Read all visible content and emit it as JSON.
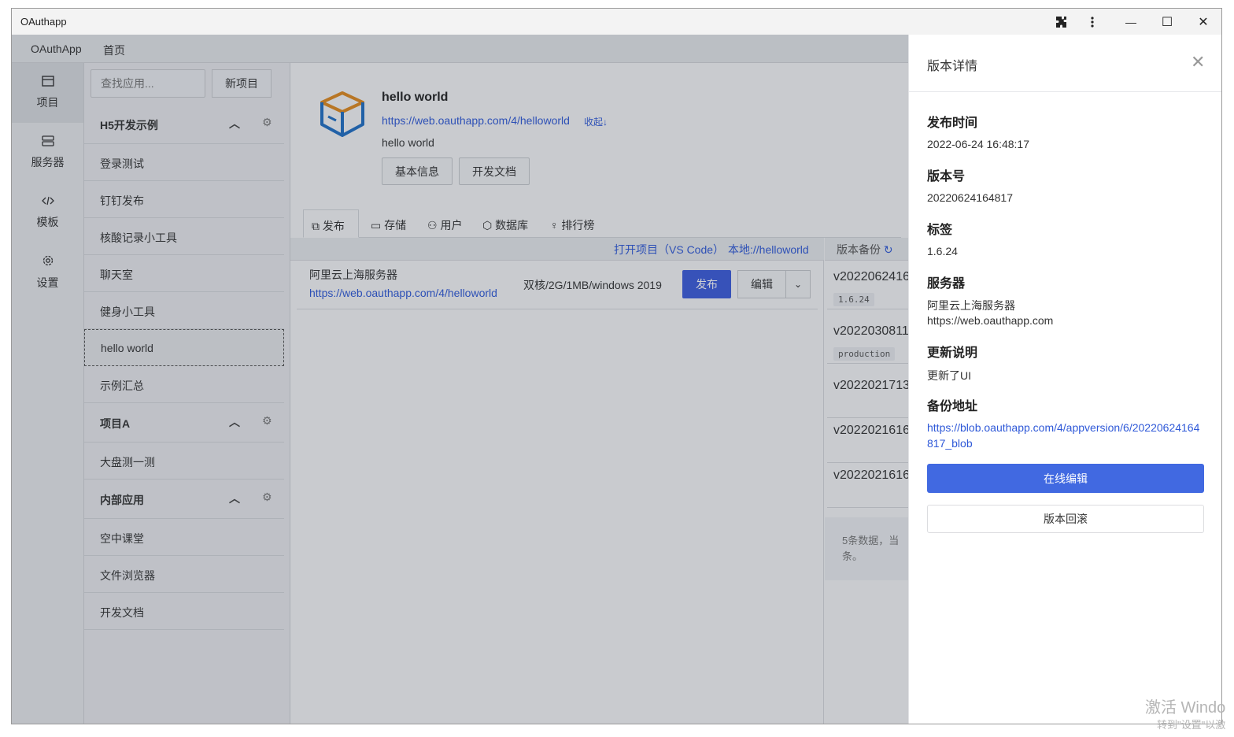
{
  "window": {
    "title": "OAuthapp"
  },
  "titlebar": {
    "extensions_icon": "puzzle-icon",
    "more_icon": "more-vertical-icon",
    "minimize": "—",
    "maximize": "☐",
    "close": "✕"
  },
  "menubar": {
    "app_name": "OAuthApp",
    "home": "首页"
  },
  "rail": {
    "items": [
      {
        "label": "项目",
        "icon": "▭"
      },
      {
        "label": "服务器",
        "icon": "☰"
      },
      {
        "label": "模板",
        "icon": "</>"
      },
      {
        "label": "设置",
        "icon": "⚙"
      }
    ]
  },
  "applist": {
    "search_placeholder": "查找应用...",
    "new_button": "新项目",
    "groups": [
      {
        "title": "H5开发示例",
        "items": [
          "登录测试",
          "钉钉发布",
          "核酸记录小工具",
          "聊天室",
          "健身小工具",
          "hello world",
          "示例汇总"
        ]
      },
      {
        "title": "项目A",
        "items": [
          "大盘测一测"
        ]
      },
      {
        "title": "内部应用",
        "items": [
          "空中课堂",
          "文件浏览器",
          "开发文档"
        ]
      }
    ]
  },
  "project": {
    "name": "hello world",
    "url": "https://web.oauthapp.com/4/helloworld",
    "collapse": "收起↓",
    "description": "hello world",
    "btn_info": "基本信息",
    "btn_docs": "开发文档"
  },
  "tabs": [
    "发布",
    "存储",
    "用户",
    "数据库",
    "排行榜"
  ],
  "deploy": {
    "open_vscode": "打开项目（VS Code）",
    "local_path": "本地://helloworld",
    "server_name": "阿里云上海服务器",
    "server_url": "https://web.oauthapp.com/4/helloworld",
    "server_spec": "双核/2G/1MB/windows 2019",
    "publish_btn": "发布",
    "edit_btn": "编辑"
  },
  "versions": {
    "header": "版本备份",
    "items": [
      {
        "version": "v2022062416",
        "tag": "1.6.24"
      },
      {
        "version": "v2022030811",
        "tag": "production"
      },
      {
        "version": "v2022021713",
        "tag": ""
      },
      {
        "version": "v2022021616",
        "tag": ""
      },
      {
        "version": "v2022021616",
        "tag": ""
      }
    ],
    "footer_line1": "5条数据，当",
    "footer_line2": "条。"
  },
  "drawer": {
    "title": "版本详情",
    "publish_time_label": "发布时间",
    "publish_time": "2022-06-24 16:48:17",
    "version_label": "版本号",
    "version": "20220624164817",
    "tag_label": "标签",
    "tag": "1.6.24",
    "server_label": "服务器",
    "server_name": "阿里云上海服务器",
    "server_url": "https://web.oauthapp.com",
    "notes_label": "更新说明",
    "notes": "更新了UI",
    "backup_label": "备份地址",
    "backup_url": "https://blob.oauthapp.com/4/appversion/6/20220624164817_blob",
    "online_edit_btn": "在线编辑",
    "rollback_btn": "版本回滚"
  },
  "watermark": {
    "line1": "激活 Windo",
    "line2": "转到\"设置\"以激"
  },
  "colors": {
    "primary": "#3b5bdb",
    "drawer_primary": "#4169e1",
    "link": "#2f59d8"
  }
}
